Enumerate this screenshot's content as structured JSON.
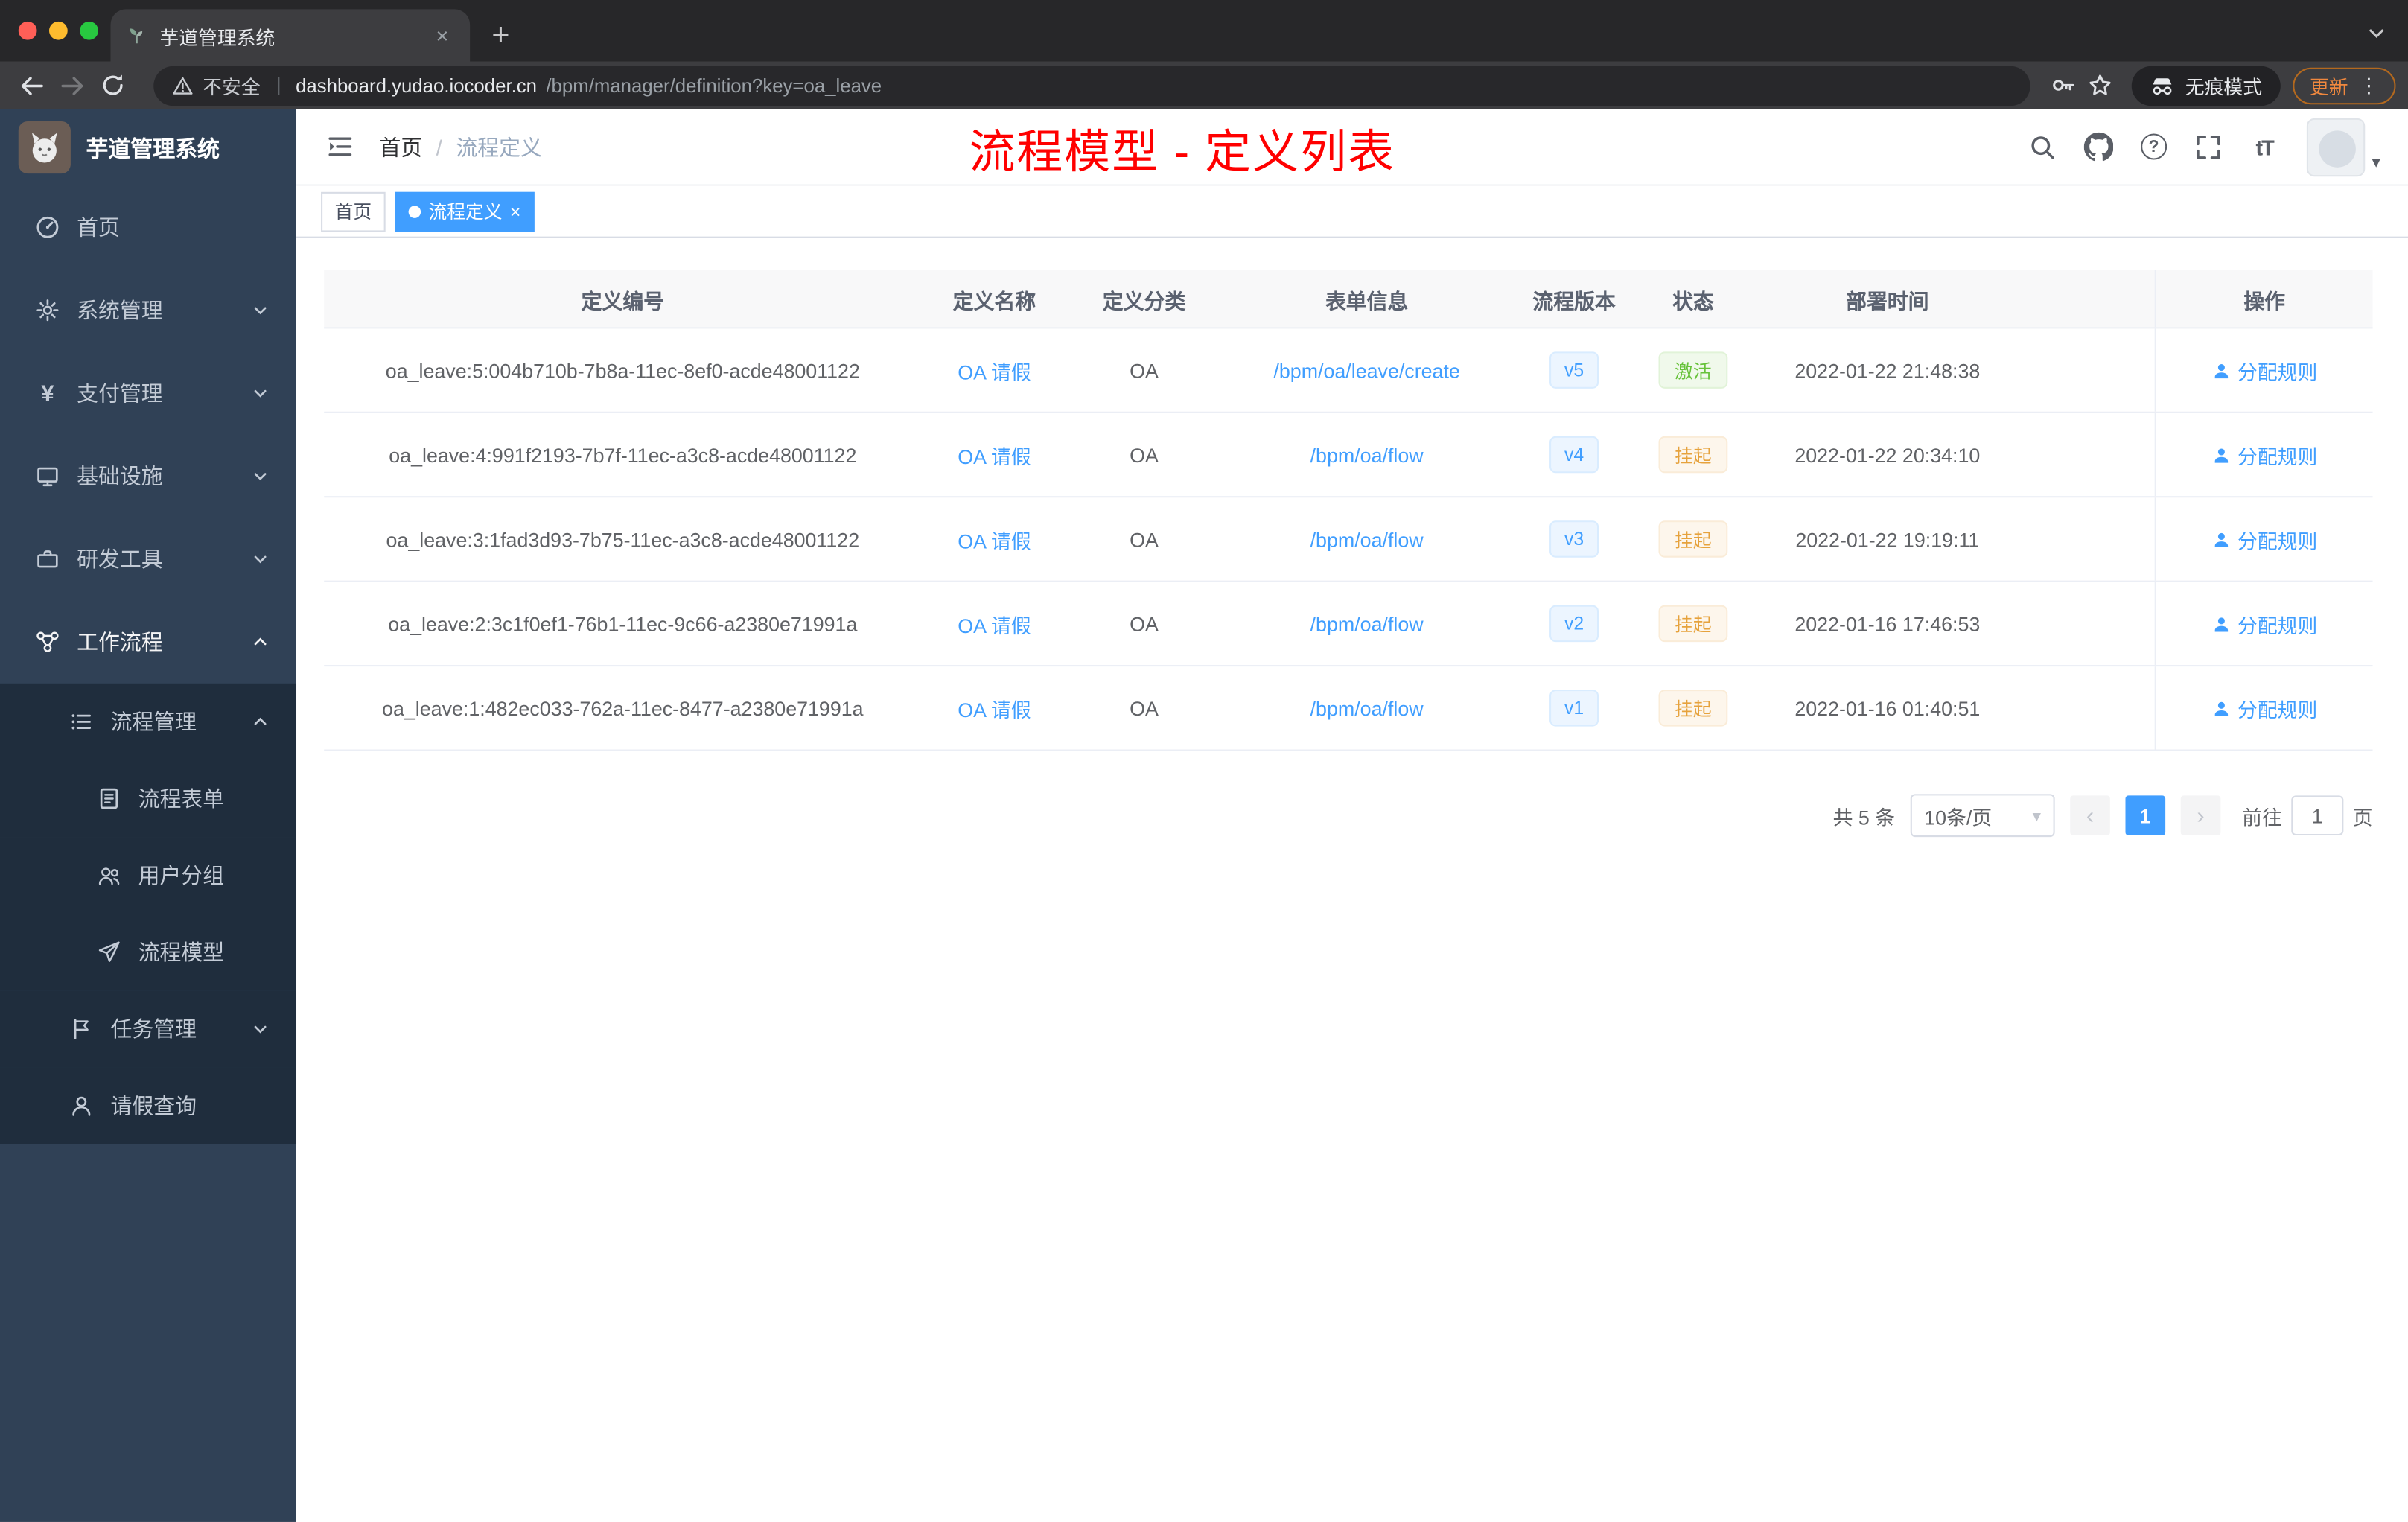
{
  "browser": {
    "tab_title": "芋道管理系统",
    "security_label": "不安全",
    "url_host": "dashboard.yudao.iocoder.cn",
    "url_path": "/bpm/manager/definition?key=oa_leave",
    "incognito_label": "无痕模式",
    "update_label": "更新"
  },
  "icons": {
    "new_tab": "+",
    "tab_close": "×",
    "tag_close": "×",
    "menu_dots": "⋮",
    "caret_down": "▾",
    "select_caret": "▾",
    "font_size": "tT",
    "yen": "¥",
    "question": "?"
  },
  "sidebar": {
    "logo_title": "芋道管理系统",
    "items": [
      {
        "label": "首页"
      },
      {
        "label": "系统管理"
      },
      {
        "label": "支付管理"
      },
      {
        "label": "基础设施"
      },
      {
        "label": "研发工具"
      },
      {
        "label": "工作流程"
      },
      {
        "label": "流程管理"
      },
      {
        "label": "流程表单"
      },
      {
        "label": "用户分组"
      },
      {
        "label": "流程模型"
      },
      {
        "label": "任务管理"
      },
      {
        "label": "请假查询"
      }
    ]
  },
  "navbar": {
    "breadcrumb_home": "首页",
    "breadcrumb_separator": "/",
    "breadcrumb_current": "流程定义",
    "annotation": "流程模型 - 定义列表"
  },
  "tags": [
    {
      "label": "首页",
      "active": false
    },
    {
      "label": "流程定义",
      "active": true
    }
  ],
  "table": {
    "columns": [
      "定义编号",
      "定义名称",
      "定义分类",
      "表单信息",
      "流程版本",
      "状态",
      "部署时间",
      "操作"
    ],
    "rows": [
      {
        "id": "oa_leave:5:004b710b-7b8a-11ec-8ef0-acde48001122",
        "name": "OA 请假",
        "category": "OA",
        "form": "/bpm/oa/leave/create",
        "version": "v5",
        "status": "激活",
        "status_type": "success",
        "deploy_time": "2022-01-22 21:48:38",
        "action": "分配规则"
      },
      {
        "id": "oa_leave:4:991f2193-7b7f-11ec-a3c8-acde48001122",
        "name": "OA 请假",
        "category": "OA",
        "form": "/bpm/oa/flow",
        "version": "v4",
        "status": "挂起",
        "status_type": "warning",
        "deploy_time": "2022-01-22 20:34:10",
        "action": "分配规则"
      },
      {
        "id": "oa_leave:3:1fad3d93-7b75-11ec-a3c8-acde48001122",
        "name": "OA 请假",
        "category": "OA",
        "form": "/bpm/oa/flow",
        "version": "v3",
        "status": "挂起",
        "status_type": "warning",
        "deploy_time": "2022-01-22 19:19:11",
        "action": "分配规则"
      },
      {
        "id": "oa_leave:2:3c1f0ef1-76b1-11ec-9c66-a2380e71991a",
        "name": "OA 请假",
        "category": "OA",
        "form": "/bpm/oa/flow",
        "version": "v2",
        "status": "挂起",
        "status_type": "warning",
        "deploy_time": "2022-01-16 17:46:53",
        "action": "分配规则"
      },
      {
        "id": "oa_leave:1:482ec033-762a-11ec-8477-a2380e71991a",
        "name": "OA 请假",
        "category": "OA",
        "form": "/bpm/oa/flow",
        "version": "v1",
        "status": "挂起",
        "status_type": "warning",
        "deploy_time": "2022-01-16 01:40:51",
        "action": "分配规则"
      }
    ]
  },
  "pagination": {
    "total": "共 5 条",
    "page_size": "10条/页",
    "current_page": "1",
    "prev_icon": "‹",
    "next_icon": "›",
    "goto_label": "前往",
    "goto_value": "1",
    "page_unit": "页"
  },
  "colors": {
    "accent": "#409eff",
    "success": "#67c23a",
    "warning": "#e6a23c",
    "annotation_red": "#ff0000",
    "sidebar_bg": "#304156",
    "submenu_bg": "#1f2d3d"
  }
}
